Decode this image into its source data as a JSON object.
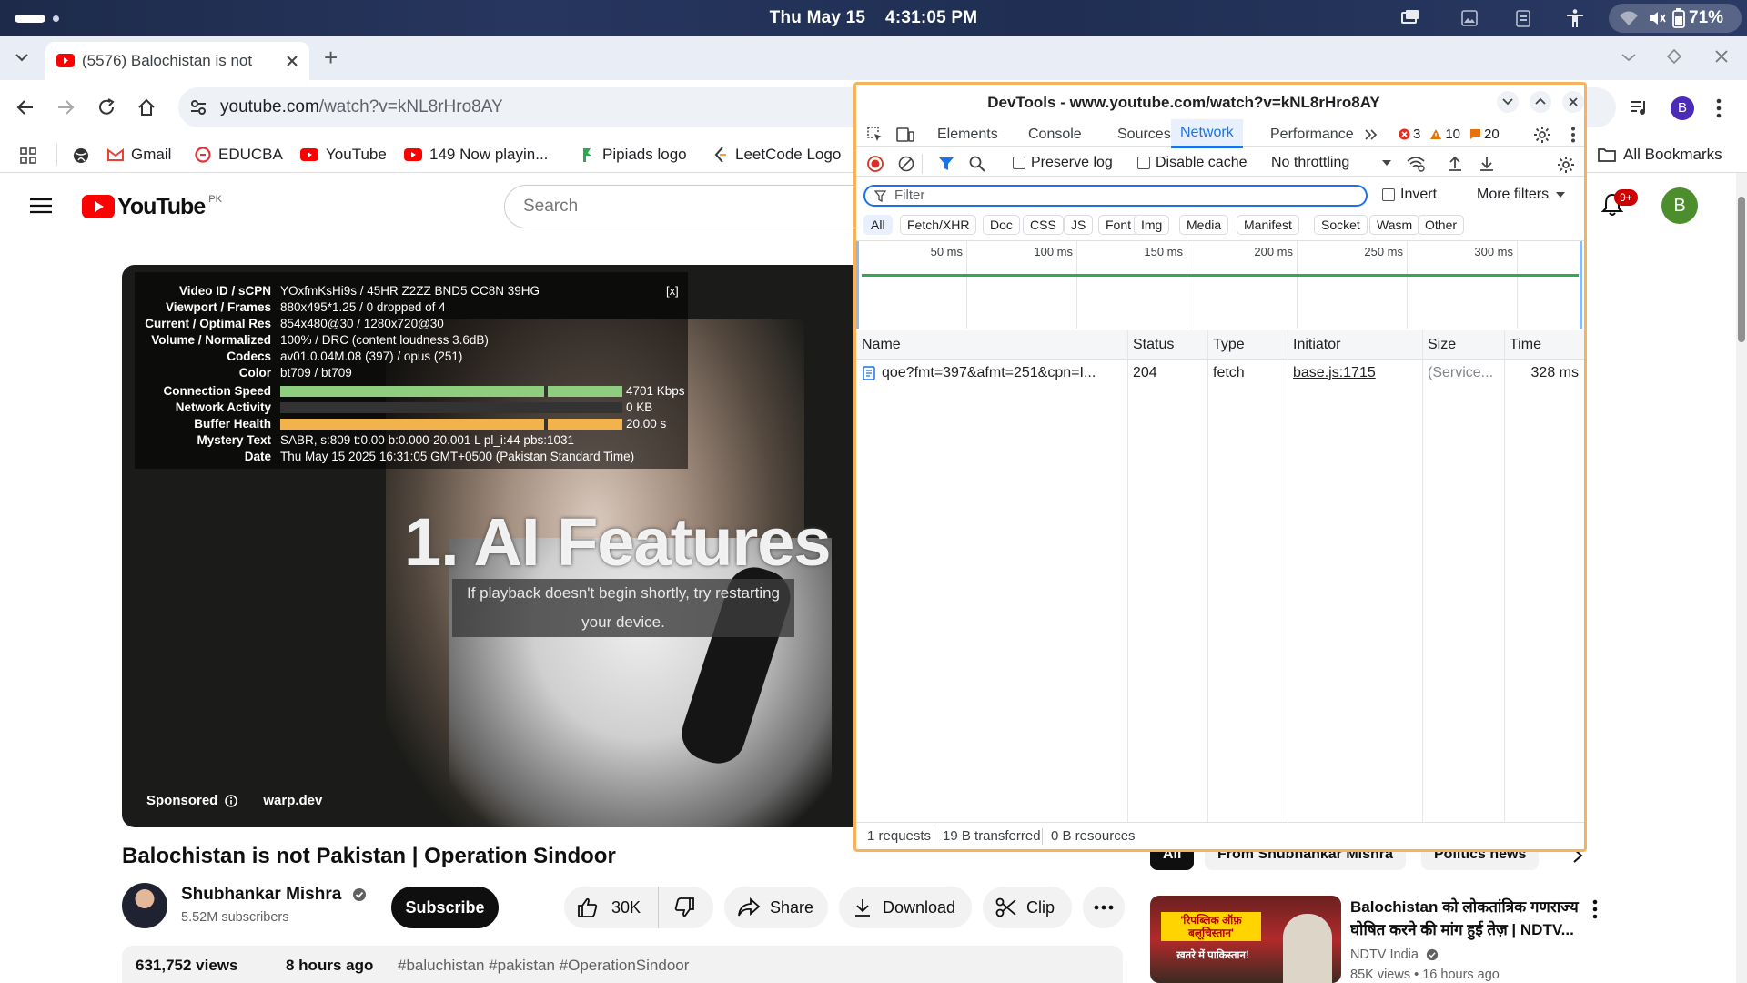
{
  "system": {
    "clock": "Thu May 15    4:31:05 PM",
    "battery": "71%"
  },
  "browser": {
    "tab_title": "(5576) Balochistan is not",
    "new_tab": "+",
    "url_host": "youtube.com",
    "url_path": "/watch?v=kNL8rHro8AY",
    "bookmarks": [
      "Gmail",
      "EDUCBA",
      "YouTube",
      "149 Now playin...",
      "Pipiads logo",
      "LeetCode Logo"
    ],
    "all_bookmarks": "All Bookmarks",
    "profile_initial": "B"
  },
  "youtube": {
    "logo_text": "YouTube",
    "region": "PK",
    "search_placeholder": "Search",
    "notif_badge": "9+",
    "avatar_initial": "B",
    "overlay_text": "1. AI Features",
    "playback_msg": "If playback doesn't begin shortly, try restarting your device.",
    "sponsored": "Sponsored",
    "sponsor_domain": "warp.dev",
    "close_stats": "[x]",
    "video_title": "Balochistan is not Pakistan | Operation Sindoor",
    "channel_name": "Shubhankar Mishra",
    "subscribers": "5.52M subscribers",
    "subscribe": "Subscribe",
    "likes": "30K",
    "share": "Share",
    "download": "Download",
    "clip": "Clip",
    "views": "631,752 views",
    "age": "8 hours ago",
    "hashtags": "#baluchistan #pakistan #OperationSindoor",
    "filter_chips": [
      "All",
      "From Shubhankar Mishra",
      "Politics news"
    ],
    "rec_title": "Balochistan को लोकतांत्रिक गणराज्य घोषित करने की मांग हुई तेज़ | NDTV...",
    "rec_channel": "NDTV India",
    "rec_meta": "85K views • 16 hours ago",
    "rec_thumb_text1": "'रिपब्लिक ऑफ़ बलूचिस्तान'",
    "rec_thumb_text2": "ख़तरे में पाकिस्तान!"
  },
  "stats": [
    {
      "k": "Video ID / sCPN",
      "v": "YOxfmKsHi9s / 45HR Z2ZZ BND5 CC8N 39HG"
    },
    {
      "k": "Viewport / Frames",
      "v": "880x495*1.25 / 0 dropped of 4"
    },
    {
      "k": "Current / Optimal Res",
      "v": "854x480@30 / 1280x720@30"
    },
    {
      "k": "Volume / Normalized",
      "v": "100% / DRC (content loudness 3.6dB)"
    },
    {
      "k": "Codecs",
      "v": "av01.0.04M.08 (397) / opus (251)"
    },
    {
      "k": "Color",
      "v": "bt709 / bt709"
    },
    {
      "k": "Connection Speed",
      "v": "4701 Kbps"
    },
    {
      "k": "Network Activity",
      "v": "0 KB"
    },
    {
      "k": "Buffer Health",
      "v": "20.00 s"
    },
    {
      "k": "Mystery Text",
      "v": "SABR, s:809 t:0.00 b:0.000-20.001 L pl_i:44 pbs:1031"
    },
    {
      "k": "Date",
      "v": "Thu May 15 2025 16:31:05 GMT+0500 (Pakistan Standard Time)"
    }
  ],
  "devtools": {
    "title": "DevTools - www.youtube.com/watch?v=kNL8rHro8AY",
    "tabs": [
      "Elements",
      "Console",
      "Sources",
      "Network",
      "Performance"
    ],
    "active_tab": "Network",
    "errors": "3",
    "warnings": "10",
    "issues": "20",
    "preserve_log": "Preserve log",
    "disable_cache": "Disable cache",
    "throttling": "No throttling",
    "filter_placeholder": "Filter",
    "invert": "Invert",
    "more_filters": "More filters",
    "type_filters": [
      "All",
      "Fetch/XHR",
      "Doc",
      "CSS",
      "JS",
      "Font",
      "Img",
      "Media",
      "Manifest",
      "Socket",
      "Wasm",
      "Other"
    ],
    "timeline_ticks": [
      "50 ms",
      "100 ms",
      "150 ms",
      "200 ms",
      "250 ms",
      "300 ms"
    ],
    "columns": [
      "Name",
      "Status",
      "Type",
      "Initiator",
      "Size",
      "Time"
    ],
    "rows": [
      {
        "name": "qoe?fmt=397&afmt=251&cpn=I...",
        "status": "204",
        "type": "fetch",
        "initiator": "base.js:1715",
        "size": "(Service...",
        "time": "328 ms"
      }
    ],
    "summary": [
      "1 requests",
      "19 B transferred",
      "0 B resources"
    ]
  },
  "colors": {
    "accent_blue": "#1a73e8",
    "yt_red": "#ff0000",
    "devtools_border": "#f6b35b",
    "timeline_green": "#34a853"
  }
}
